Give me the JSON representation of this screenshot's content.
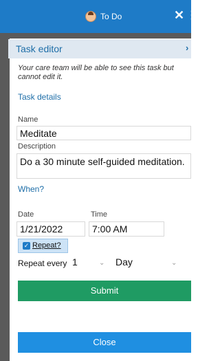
{
  "header": {
    "title": "To Do",
    "close_icon": "✕",
    "more_icon": "⋮"
  },
  "editor": {
    "title": "Task editor",
    "close_icon": "›"
  },
  "note": "Your care team will be able to see this task but cannot edit it.",
  "sections": {
    "task_details": "Task details",
    "when": "When?"
  },
  "fields": {
    "name_label": "Name",
    "name_value": "Meditate",
    "description_label": "Description",
    "description_value": "Do a 30 minute self-guided meditation.",
    "date_label": "Date",
    "date_value": "1/21/2022",
    "time_label": "Time",
    "time_value": "7:00 AM"
  },
  "repeat": {
    "checked": true,
    "label": "Repeat?"
  },
  "repeat_every": {
    "label": "Repeat every",
    "count": "1",
    "unit": "Day"
  },
  "buttons": {
    "submit": "Submit",
    "close": "Close"
  },
  "colors": {
    "accent": "#1e7bc7",
    "submit": "#1f9b63",
    "close": "#1f8fe1"
  }
}
